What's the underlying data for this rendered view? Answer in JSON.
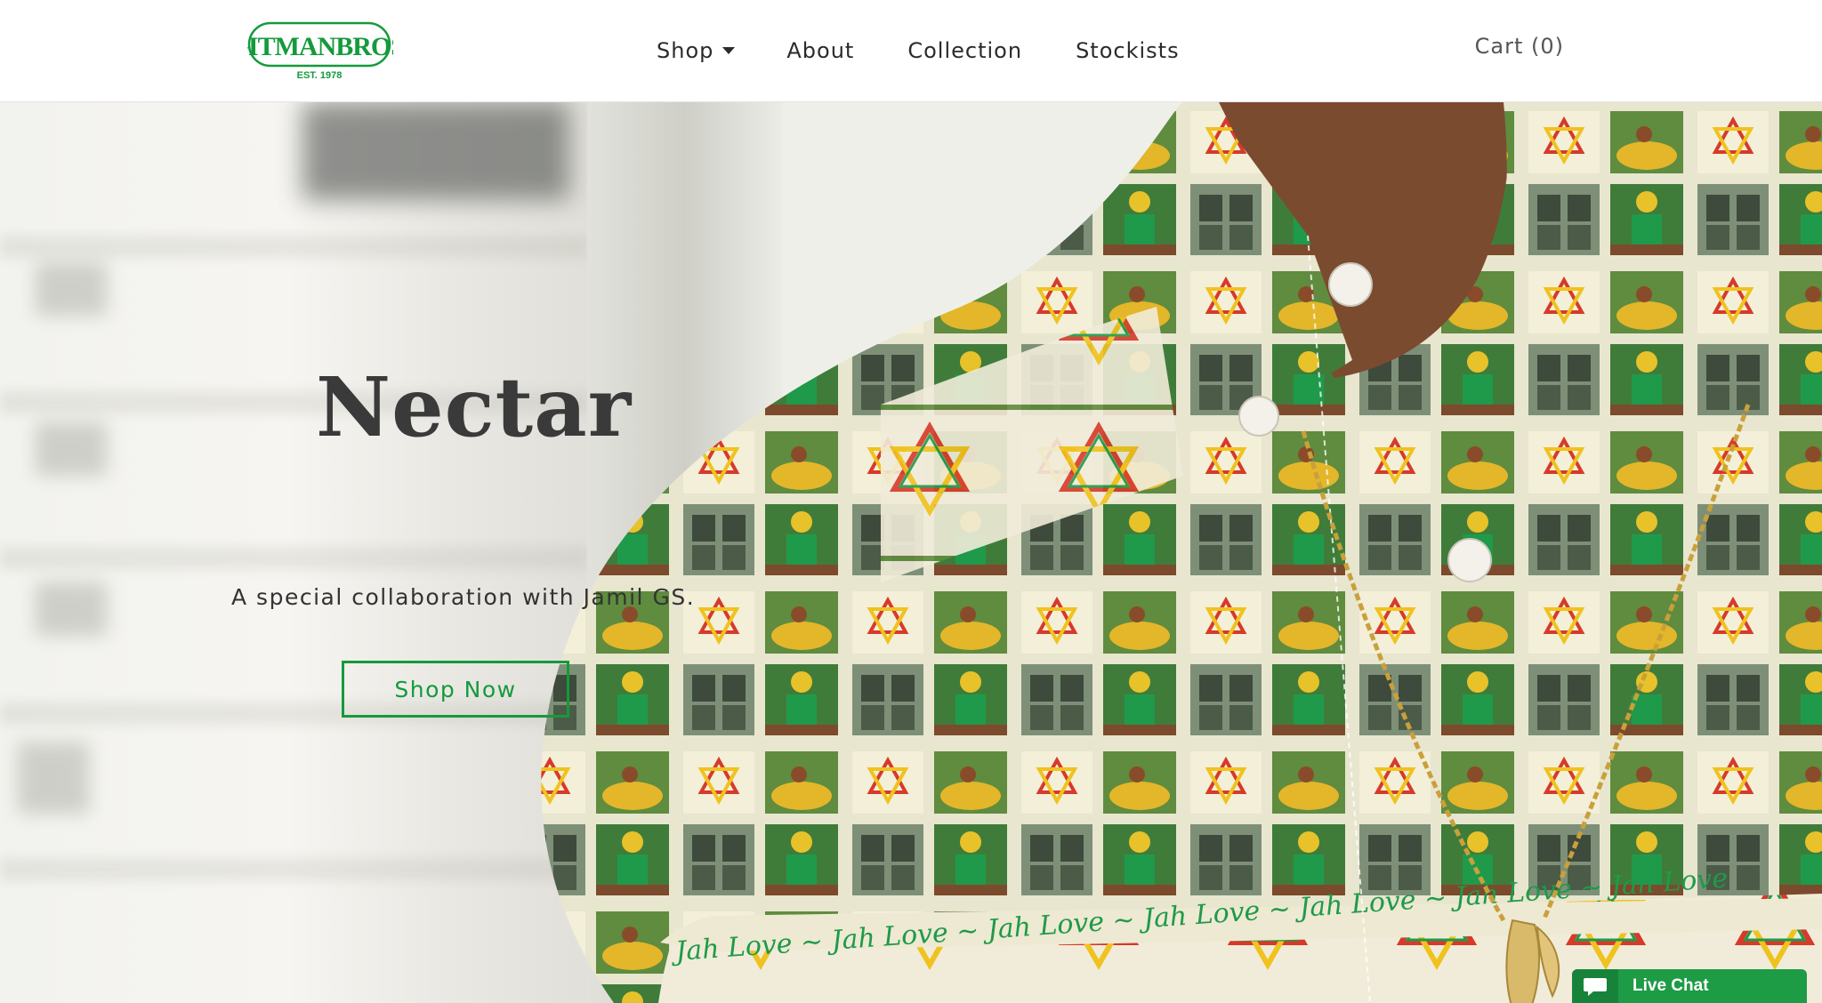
{
  "brand": {
    "logo_text": "GITMAN BROS.",
    "logo_tagline": "EST. 1978",
    "color": "#149a3c"
  },
  "nav": {
    "items": [
      {
        "label": "Shop",
        "has_dropdown": true
      },
      {
        "label": "About"
      },
      {
        "label": "Collection"
      },
      {
        "label": "Stockists"
      }
    ]
  },
  "cart": {
    "label": "Cart (0)"
  },
  "hero": {
    "title": "Nectar",
    "subtitle": "A special collaboration with Jamil GS.",
    "cta_label": "Shop Now",
    "accent_color": "#149a3c"
  },
  "chat": {
    "label": "Live Chat",
    "icon": "chat-bubble-icon",
    "color": "#1e9b45"
  }
}
